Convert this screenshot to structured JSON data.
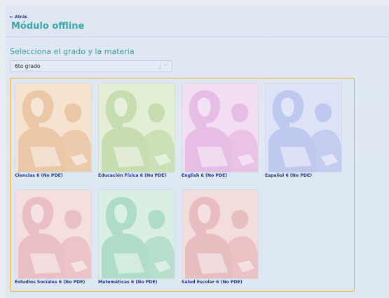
{
  "header": {
    "back_label": "Atrás",
    "title": "Módulo offline"
  },
  "section": {
    "subtitle": "Selecciona el grado y la materia",
    "grade_select": {
      "value": "6to grado"
    }
  },
  "subjects": [
    {
      "label": "Ciencias 6 (No PDE)",
      "bg": "#f6e3cf",
      "accent": "#eac7a6"
    },
    {
      "label": "Educación Física 6 (No PDE)",
      "bg": "#e3efd4",
      "accent": "#c7ddb0"
    },
    {
      "label": "English 6 (No PDE)",
      "bg": "#f3ddf2",
      "accent": "#e6bde4"
    },
    {
      "label": "Español 6 (No PDE)",
      "bg": "#dde2f7",
      "accent": "#bfc8ef"
    },
    {
      "label": "Estudios Sociales 6 (No PDE)",
      "bg": "#f5dede",
      "accent": "#eabfc3"
    },
    {
      "label": "Matemáticas 6 (No PDE)",
      "bg": "#d9efe4",
      "accent": "#aedcc6"
    },
    {
      "label": "Salud Escolar 6 (No PDE)",
      "bg": "#f3dcdc",
      "accent": "#e8bdbf"
    }
  ]
}
